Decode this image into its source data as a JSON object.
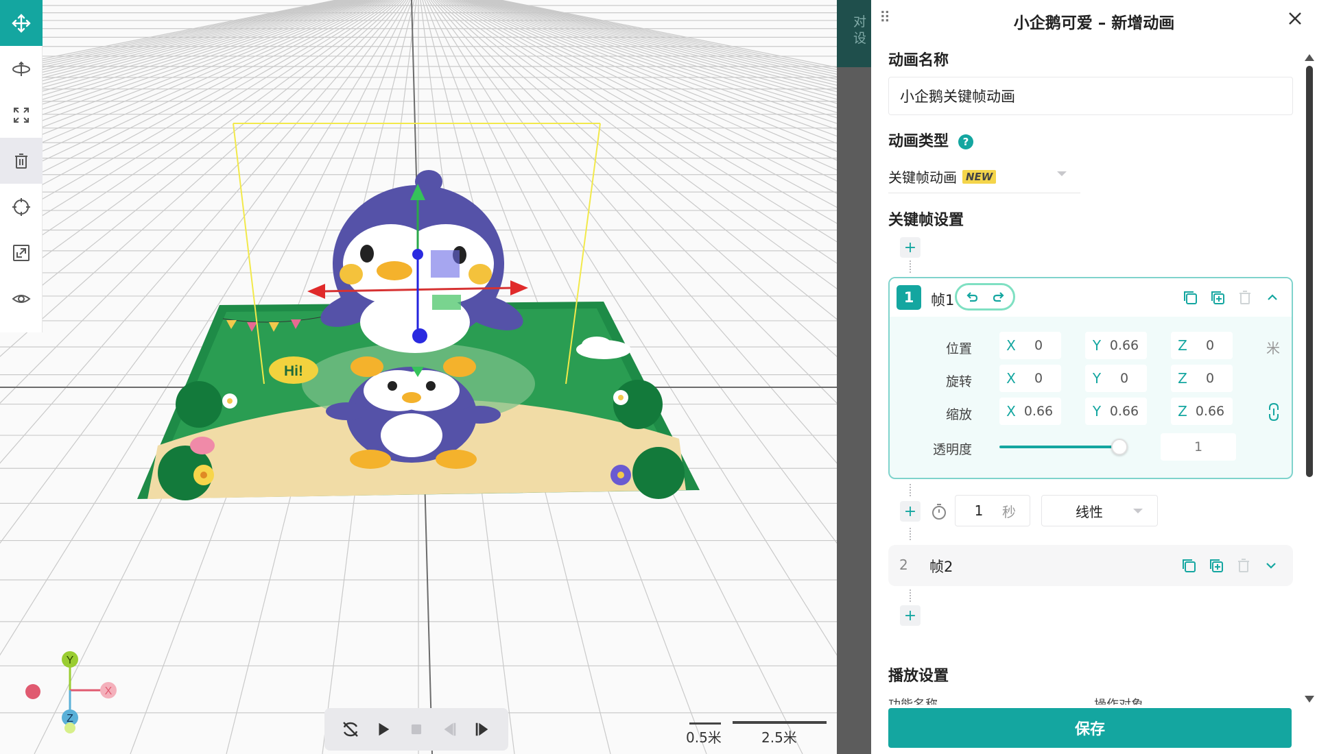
{
  "panel": {
    "title": "小企鹅可爱 – 新增动画",
    "name_label": "动画名称",
    "name_value": "小企鹅关键帧动画",
    "type_label": "动画类型",
    "type_value": "关键帧动画",
    "type_badge": "NEW",
    "keyframe_label": "关键帧设置",
    "frame1": {
      "number": "1",
      "name": "帧1",
      "rows": {
        "position": {
          "label": "位置",
          "x": "0",
          "y": "0.66",
          "z": "0",
          "unit": "米"
        },
        "rotation": {
          "label": "旋转",
          "x": "0",
          "y": "0",
          "z": "0"
        },
        "scale": {
          "label": "缩放",
          "x": "0.66",
          "y": "0.66",
          "z": "0.66"
        }
      },
      "opacity_label": "透明度",
      "opacity_value": "1",
      "axis_x": "X",
      "axis_y": "Y",
      "axis_z": "Z"
    },
    "transition": {
      "duration": "1",
      "unit": "秒",
      "easing": "线性"
    },
    "frame2": {
      "number": "2",
      "name": "帧2"
    },
    "playback_label": "播放设置",
    "playback_col1": "功能名称",
    "playback_col2": "操作对象",
    "save_label": "保存"
  },
  "strip_text": "对设",
  "scale": {
    "small": "0.5米",
    "large": "2.5米"
  },
  "axis_labels": {
    "x": "X",
    "y": "Y",
    "z": "Z"
  },
  "scene": {
    "sign_text": "Hi!"
  },
  "toolbar_icons": [
    "move-icon",
    "rotate-icon",
    "scale-icon",
    "delete-icon",
    "target-icon",
    "fit-icon",
    "eye-icon"
  ],
  "colors": {
    "accent": "#14a6a0",
    "penguin": "#4a4a9a"
  }
}
